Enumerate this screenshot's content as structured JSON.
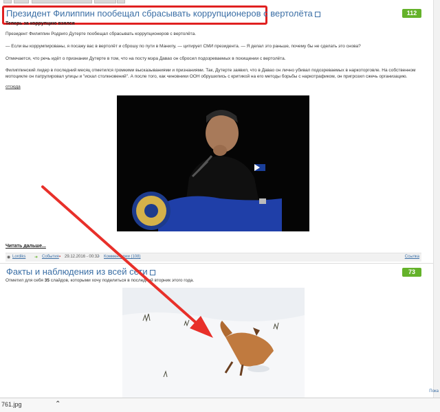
{
  "post1": {
    "title": "Президент Филиппин пообещал сбрасывать коррупционеров с вертолёта",
    "rating": "112",
    "subheading": "Теперь за коррупцию взялся",
    "paragraphs": [
      "Президент Филиппин Родриго Дутерте пообещал сбрасывать коррупционеров с вертолёта.",
      "— Если вы коррумпированы, я посажу вас в вертолёт и сброшу по пути в Манилу, — цитирует СМИ президента. — Я делал это раньше, почему бы не сделать это снова?",
      "Отмечается, что речь идёт о признании Дутерте в том, что на посту мэра Давао он сбросил подозреваемых в похищении с вертолёта.",
      "Филиппинский лидер в последний месяц отметился громкими высказываниями и признаниями. Так, Дутерте заявил, что в Давао он лично убивал подозреваемых в наркоторговле. На собственном мотоцикле он патрулировал улицы и \"искал столкновений\". А после того, как чиновники ООН обрушились с критикой на его методы борьбы с наркотрафиком, он пригрозил сжечь организацию."
    ],
    "source_link": "отсюда",
    "read_more": "Читать дальше...",
    "meta": {
      "author": "Lordiks",
      "category": "События",
      "date": "29.12.2016 - 00:32",
      "comments": "Комментарии (108)",
      "share": "Ссылка"
    }
  },
  "post2": {
    "title": "Факты и наблюдения из всей сети",
    "rating": "73",
    "intro_start": "Отметил для себя ",
    "intro_count": "35",
    "intro_end": " слайдов, которыми хочу поделиться в последний вторник этого года."
  },
  "download_bar": {
    "filename": "761.jpg",
    "right_label": "Пока"
  },
  "colors": {
    "title_link": "#3a6ea5",
    "rating_green": "#64b22a",
    "highlight_red": "#e02020"
  }
}
